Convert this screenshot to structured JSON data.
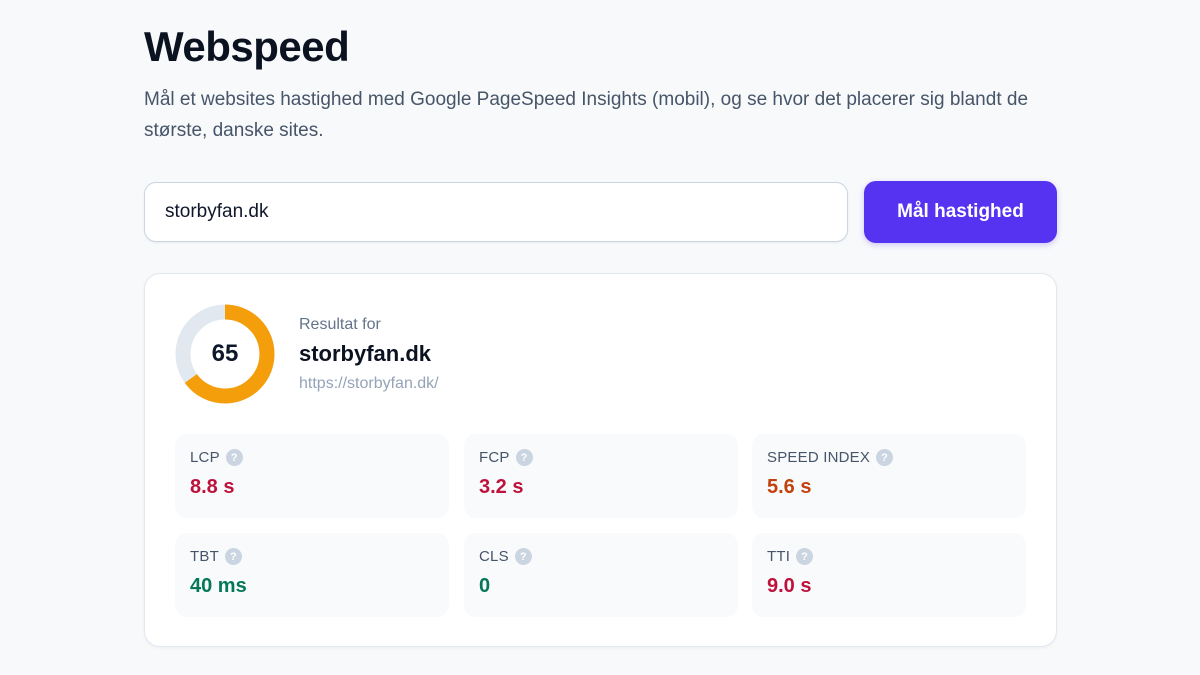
{
  "header": {
    "title": "Webspeed",
    "subtitle": "Mål et websites hastighed med Google PageSpeed Insights (mobil), og se hvor det placerer sig blandt de største, danske sites."
  },
  "search": {
    "value": "storbyfan.dk",
    "button_label": "Mål hastighed"
  },
  "result": {
    "score": "65",
    "score_fraction": 0.65,
    "score_color": "#f59e0b",
    "track_color": "#e2e8f0",
    "label": "Resultat for",
    "domain": "storbyfan.dk",
    "url": "https://storbyfan.dk/",
    "metrics": [
      {
        "name": "LCP",
        "value": "8.8 s",
        "color": "#be123c",
        "icon": "help-icon"
      },
      {
        "name": "FCP",
        "value": "3.2 s",
        "color": "#be123c",
        "icon": "help-icon"
      },
      {
        "name": "SPEED INDEX",
        "value": "5.6 s",
        "color": "#c2410c",
        "icon": "help-icon"
      },
      {
        "name": "TBT",
        "value": "40 ms",
        "color": "#047857",
        "icon": "help-icon"
      },
      {
        "name": "CLS",
        "value": "0",
        "color": "#047857",
        "icon": "help-icon"
      },
      {
        "name": "TTI",
        "value": "9.0 s",
        "color": "#be123c",
        "icon": "help-icon"
      }
    ]
  },
  "colors": {
    "accent": "#5533f0"
  }
}
